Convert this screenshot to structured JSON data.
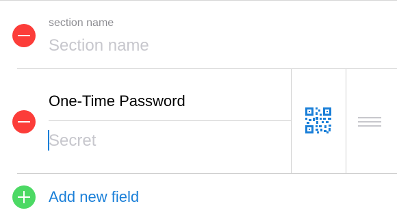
{
  "section": {
    "label": "section name",
    "placeholder": "Section name"
  },
  "field": {
    "title": "One-Time Password",
    "value_placeholder": "Secret",
    "qr_icon": "qr-code-icon",
    "drag_icon": "reorder-handle-icon"
  },
  "add_field": {
    "label": "Add new field"
  },
  "colors": {
    "delete": "#fc3d39",
    "add": "#4cd964",
    "accent": "#1a7fd8"
  }
}
